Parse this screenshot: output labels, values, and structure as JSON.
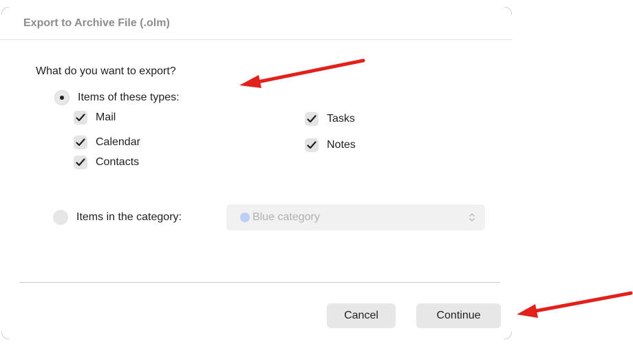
{
  "dialog": {
    "title": "Export to Archive File (.olm)",
    "question": "What do you want to export?"
  },
  "options": {
    "types_radio": {
      "label": "Items of these types:",
      "selected": true
    },
    "category_radio": {
      "label": "Items in the category:",
      "selected": false
    }
  },
  "item_types": [
    {
      "label": "Mail",
      "checked": true
    },
    {
      "label": "Calendar",
      "checked": true
    },
    {
      "label": "Contacts",
      "checked": true
    },
    {
      "label": "Tasks",
      "checked": true
    },
    {
      "label": "Notes",
      "checked": true
    }
  ],
  "category": {
    "selected": "Blue category",
    "color": "#b9cff3",
    "icon": "chevron-updown-icon"
  },
  "buttons": {
    "cancel": "Cancel",
    "continue": "Continue"
  },
  "annotations": {
    "arrow_color": "#e3211c",
    "icons": [
      "red-arrow-annotation",
      "red-arrow-annotation"
    ]
  },
  "colors": {
    "title": "#8d8d8d",
    "text": "#1f1f1f",
    "button_bg": "#e7e7e7"
  }
}
